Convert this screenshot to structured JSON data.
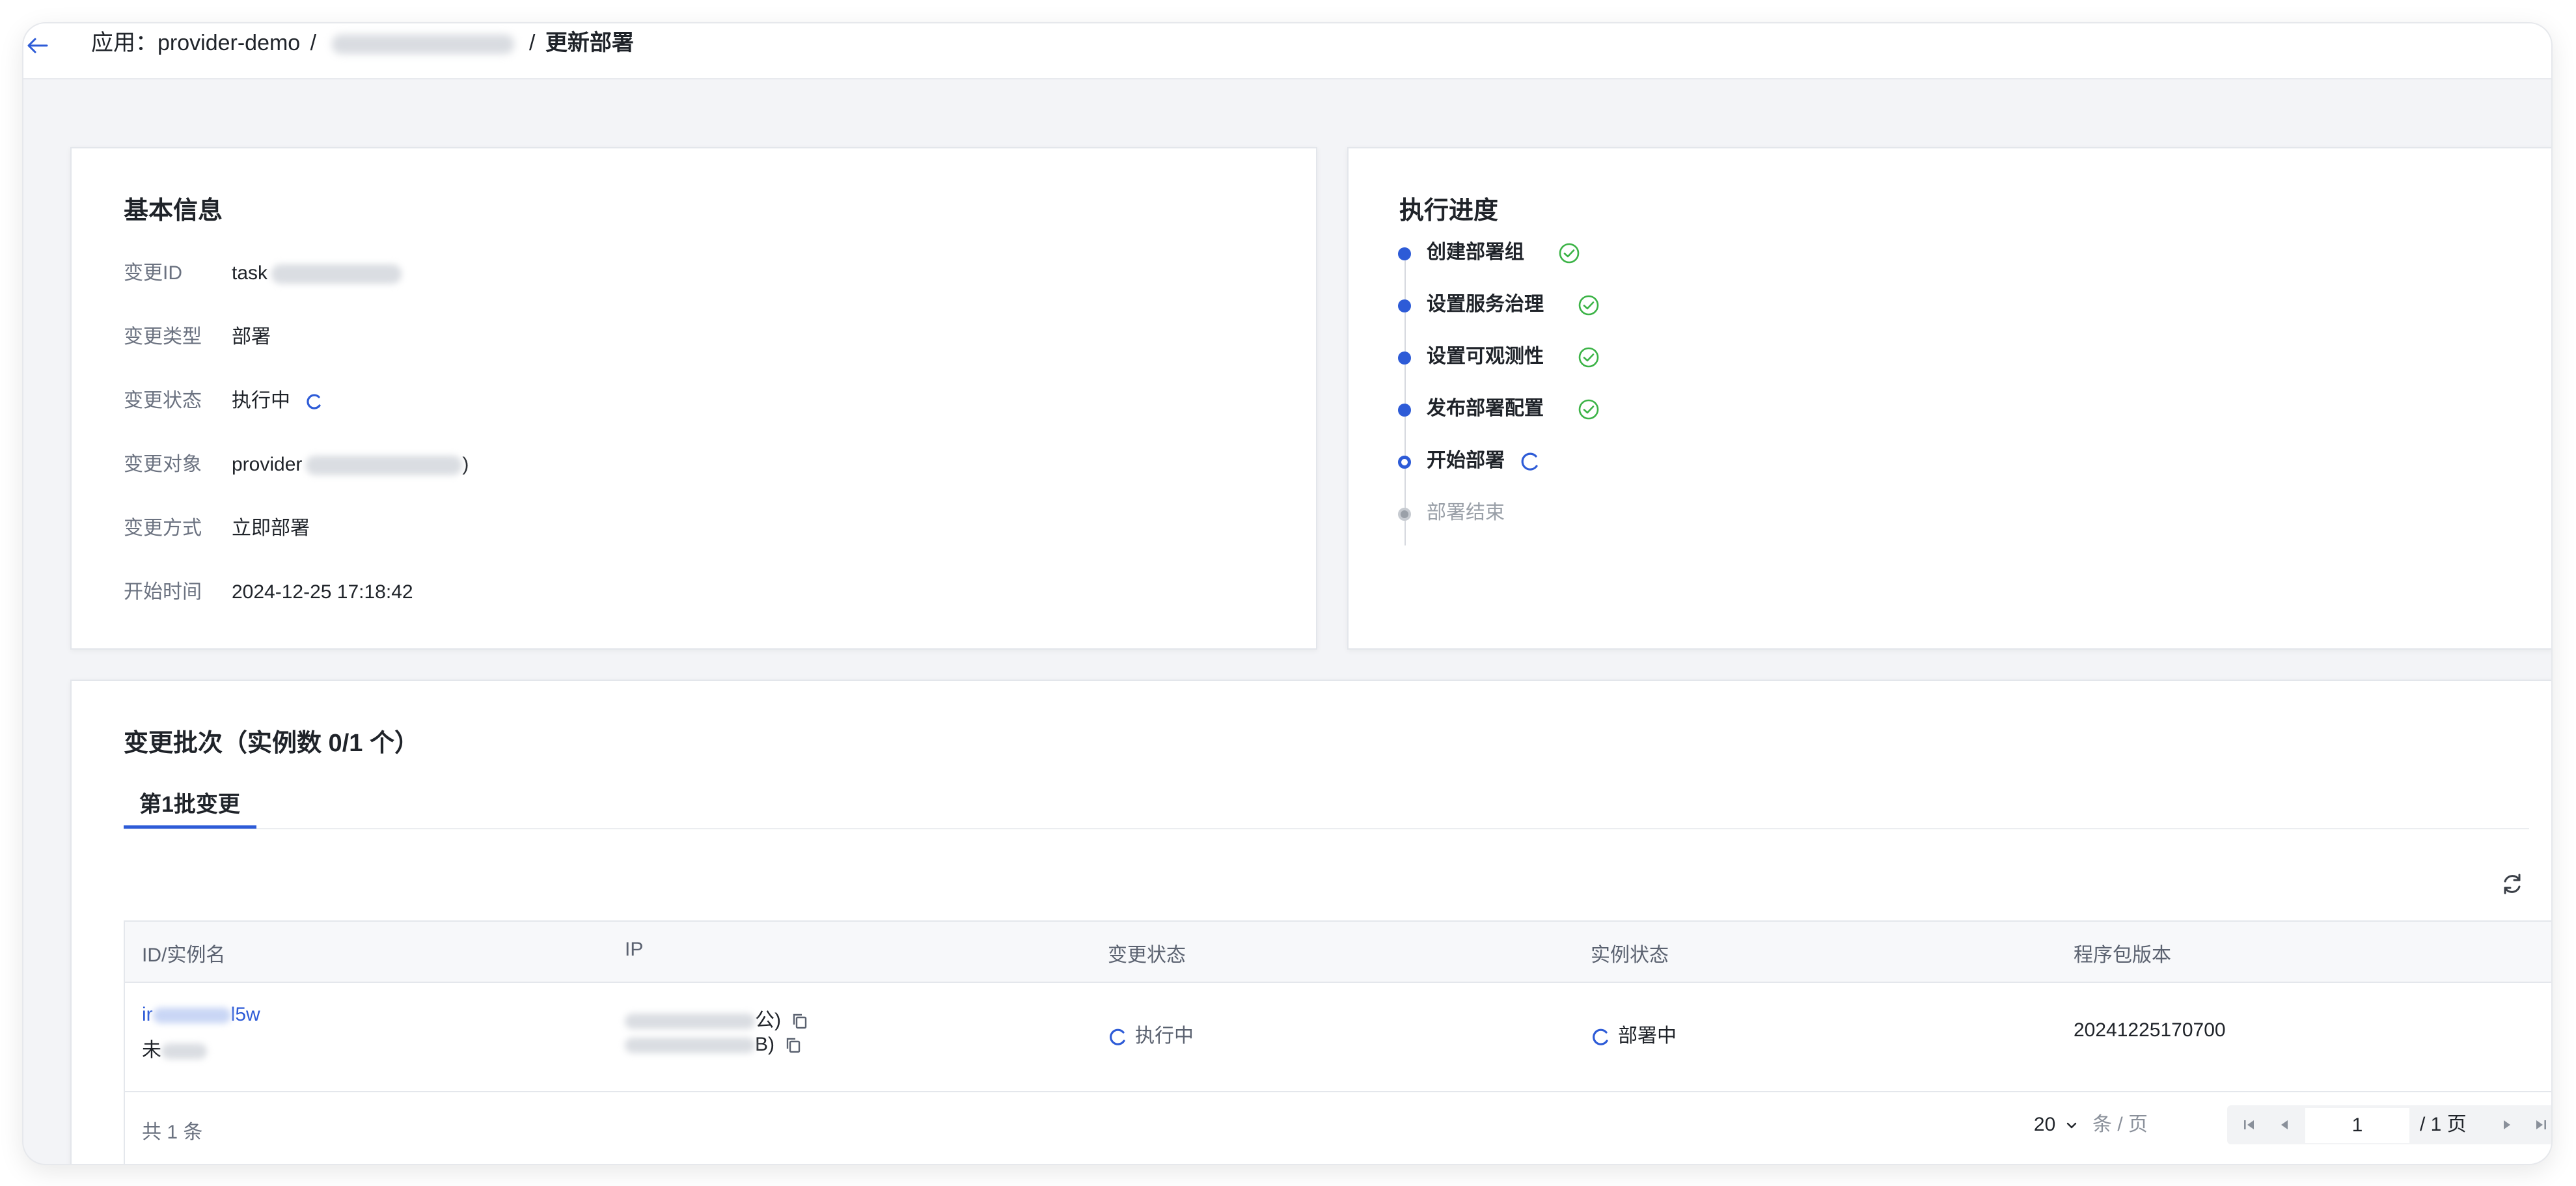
{
  "breadcrumb": {
    "app_prefix": "应用：provider-demo",
    "sep1": "/",
    "sep2": "/",
    "current": "更新部署"
  },
  "basic_info": {
    "title": "基本信息",
    "rows": [
      {
        "label": "变更ID",
        "value": "task"
      },
      {
        "label": "变更类型",
        "value": "部署"
      },
      {
        "label": "变更状态",
        "value": "执行中"
      },
      {
        "label": "变更对象",
        "value": "provider",
        "suffix": ")"
      },
      {
        "label": "变更方式",
        "value": "立即部署"
      },
      {
        "label": "开始时间",
        "value": "2024-12-25 17:18:42"
      }
    ]
  },
  "progress": {
    "title": "执行进度",
    "steps": [
      {
        "label": "创建部署组",
        "state": "done"
      },
      {
        "label": "设置服务治理",
        "state": "done"
      },
      {
        "label": "设置可观测性",
        "state": "done"
      },
      {
        "label": "发布部署配置",
        "state": "done"
      },
      {
        "label": "开始部署",
        "state": "running"
      },
      {
        "label": "部署结束",
        "state": "pending"
      }
    ]
  },
  "batch": {
    "title": "变更批次（实例数 0/1 个）",
    "tab_label": "第1批变更",
    "columns": [
      "ID/实例名",
      "IP",
      "变更状态",
      "实例状态",
      "程序包版本"
    ],
    "row": {
      "id_prefix": "ir",
      "id_suffix": "l5w",
      "name_prefix": "未",
      "ip_line1_suffix": "公)",
      "ip_line2_suffix": "B)",
      "change_status": "执行中",
      "instance_status": "部署中",
      "package_version": "20241225170700"
    },
    "footer": {
      "total": "共 1 条",
      "page_size": "20",
      "page_size_unit": "条 / 页",
      "current_page": "1",
      "page_total": "/ 1 页"
    }
  },
  "colors": {
    "accent": "#2d5bd7",
    "success": "#3bb346",
    "muted": "#9aa0a8"
  },
  "icons": [
    "back-arrow-icon",
    "spinner-icon",
    "check-circle-icon",
    "refresh-icon",
    "copy-icon",
    "first-page-icon",
    "prev-page-icon",
    "next-page-icon",
    "last-page-icon",
    "chevron-down-icon"
  ]
}
